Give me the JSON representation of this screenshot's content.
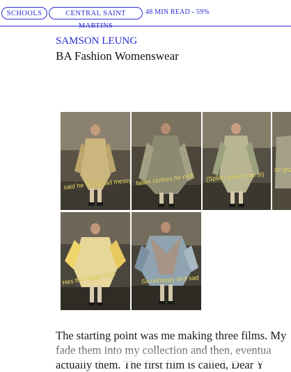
{
  "nav": {
    "tags": [
      "SCHOOLS",
      "CENTRAL SAINT MARTINS"
    ],
    "read_info": "48 MIN READ - 59%"
  },
  "article": {
    "designer": "SAMSON LEUNG",
    "course": "BA Fashion Womenswear"
  },
  "gallery": {
    "captions": [
      "said he \"it's a sad messy\"",
      "fallen clothes he nich",
      "(Splish splash me st)",
      "so griz",
      "Hes the happy boy!",
      "So unhappy and sad"
    ]
  },
  "body": {
    "lines": [
      "The starting point was me making three films. My",
      "fade them into my collection and then, eventua",
      "actually them. The first film is called, Dear Y"
    ]
  },
  "colors": {
    "accent": "#2a2ad4",
    "caption": "#f3e36a"
  }
}
